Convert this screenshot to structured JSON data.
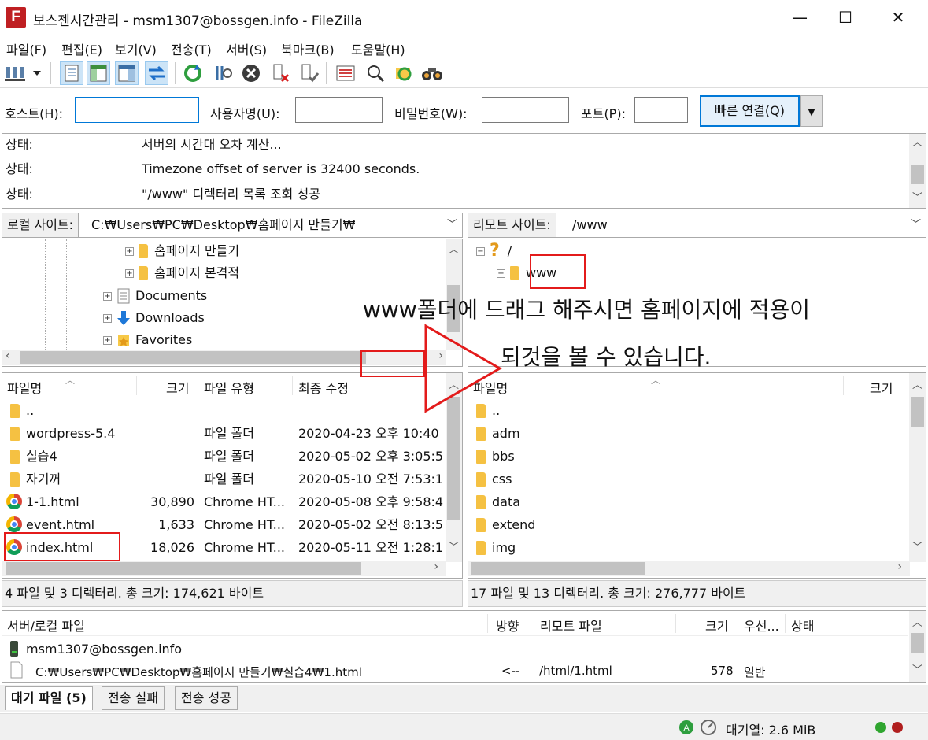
{
  "window": {
    "title": "보스젠시간관리 - msm1307@bossgen.info - FileZilla",
    "app_icon": "F",
    "minimize": "—",
    "maximize": "☐",
    "close": "✕"
  },
  "menu": [
    "파일(F)",
    "편집(E)",
    "보기(V)",
    "전송(T)",
    "서버(S)",
    "북마크(B)",
    "도움말(H)"
  ],
  "toolbar": {
    "icons": [
      "site-manager-icon",
      "dropdown-arrow-icon",
      "message-log-icon",
      "local-tree-icon",
      "remote-tree-icon",
      "transfer-queue-icon",
      "refresh-icon",
      "process-queue-icon",
      "cancel-icon",
      "disconnect-icon",
      "reconnect-icon",
      "dir-listing-filter-icon",
      "compare-icon",
      "sync-browse-icon",
      "search-icon"
    ]
  },
  "quickconnect": {
    "host_label": "호스트(H):",
    "host_value": "",
    "user_label": "사용자명(U):",
    "user_value": "",
    "pass_label": "비밀번호(W):",
    "pass_value": "",
    "port_label": "포트(P):",
    "port_value": "",
    "connect_label": "빠른 연결(Q)",
    "dropdown": "▼"
  },
  "log": [
    {
      "label": "상태:",
      "msg": "서버의 시간대 오차 계산..."
    },
    {
      "label": "상태:",
      "msg": "Timezone offset of server is 32400 seconds."
    },
    {
      "label": "상태:",
      "msg": "\"/www\" 디렉터리 목록 조회 성공"
    }
  ],
  "local": {
    "site_label": "로컬 사이트:",
    "path": "C:₩Users₩PC₩Desktop₩홈페이지 만들기₩",
    "tree": [
      {
        "label": "홈페이지 만들기",
        "icon": "folder-icon"
      },
      {
        "label": "홈페이지 본격적",
        "icon": "folder-icon"
      },
      {
        "label": "Documents",
        "icon": "documents-icon"
      },
      {
        "label": "Downloads",
        "icon": "downloads-icon"
      },
      {
        "label": "Favorites",
        "icon": "favorites-icon"
      }
    ],
    "columns": {
      "name": "파일명",
      "size": "크기",
      "type": "파일 유형",
      "modified": "최종 수정"
    },
    "files": [
      {
        "name": "..",
        "size": "",
        "type": "",
        "modified": "",
        "icon": "folder-icon"
      },
      {
        "name": "wordpress-5.4",
        "size": "",
        "type": "파일 폴더",
        "modified": "2020-04-23 오후 10:40",
        "icon": "folder-icon"
      },
      {
        "name": "실습4",
        "size": "",
        "type": "파일 폴더",
        "modified": "2020-05-02 오후 3:05:5",
        "icon": "folder-icon"
      },
      {
        "name": "자기꺼",
        "size": "",
        "type": "파일 폴더",
        "modified": "2020-05-10 오전 7:53:1",
        "icon": "folder-icon"
      },
      {
        "name": "1-1.html",
        "size": "30,890",
        "type": "Chrome HT...",
        "modified": "2020-05-08 오후 9:58:4",
        "icon": "chrome-icon"
      },
      {
        "name": "event.html",
        "size": "1,633",
        "type": "Chrome HT...",
        "modified": "2020-05-02 오전 8:13:5",
        "icon": "chrome-icon"
      },
      {
        "name": "index.html",
        "size": "18,026",
        "type": "Chrome HT...",
        "modified": "2020-05-11 오전 1:28:1",
        "icon": "chrome-icon"
      }
    ],
    "status": "4 파일 및 3 디렉터리. 총 크기: 174,621 바이트"
  },
  "remote": {
    "site_label": "리모트 사이트:",
    "path": "/www",
    "tree": [
      {
        "label": "/",
        "icon": "unknown-folder-icon"
      },
      {
        "label": "www",
        "icon": "folder-icon"
      }
    ],
    "columns": {
      "name": "파일명",
      "size": "크기"
    },
    "files": [
      "..",
      "adm",
      "bbs",
      "css",
      "data",
      "extend",
      "img"
    ],
    "status": "17 파일 및 13 디렉터리. 총 크기: 276,777 바이트"
  },
  "annotation": {
    "line1": "www폴더에 드래그 해주시면 홈페이지에 적용이",
    "line2": "되것을 볼 수 있습니다."
  },
  "queue": {
    "columns": {
      "server_local": "서버/로컬 파일",
      "direction": "방향",
      "remote_file": "리모트 파일",
      "size": "크기",
      "priority": "우선...",
      "status": "상태"
    },
    "server": "msm1307@bossgen.info",
    "item": {
      "local": "C:₩Users₩PC₩Desktop₩홈페이지 만들기₩실습4₩1.html",
      "direction": "<--",
      "remote": "/html/1.html",
      "size": "578",
      "priority": "일반"
    }
  },
  "tabs": [
    "대기 파일 (5)",
    "전송 실패",
    "전송 성공"
  ],
  "footer": {
    "queue_label": "대기열: 2.6 MiB"
  },
  "colors": {
    "accent": "#0078d7",
    "highlight_box": "#e31b1b",
    "folder": "#f7c948"
  }
}
